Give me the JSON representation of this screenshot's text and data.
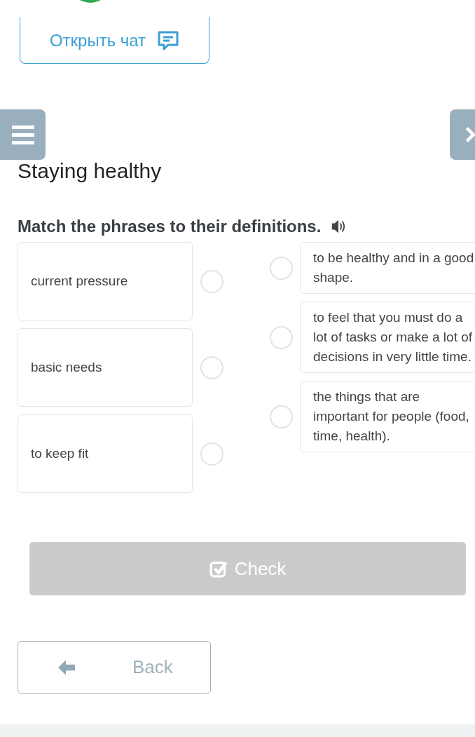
{
  "chat_button": {
    "label": "Открыть чат"
  },
  "title": "Staying healthy",
  "instruction": "Match the phrases to their definitions.",
  "phrases": [
    {
      "text": "current pressure",
      "selected": false
    },
    {
      "text": "basic needs",
      "selected": false
    },
    {
      "text": "to keep fit",
      "selected": false
    }
  ],
  "definitions": [
    {
      "text": "to be healthy and in a good shape.",
      "selected": false
    },
    {
      "text": "to feel that you must do a lot of tasks or make a lot of decisions in very little time.",
      "selected": false
    },
    {
      "text": "the things that are important for people (food, time, health).",
      "selected": false
    }
  ],
  "check_button": {
    "label": "Check",
    "disabled": true
  },
  "back_button": {
    "label": "Back"
  }
}
